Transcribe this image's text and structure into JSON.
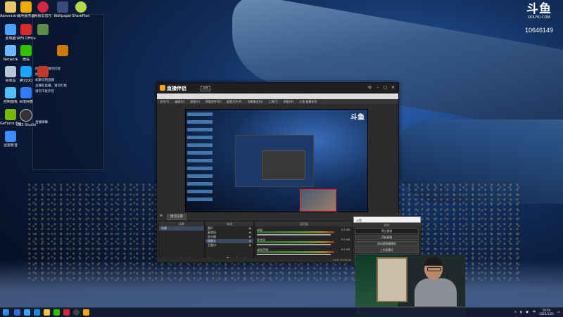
{
  "desktop": {
    "icons_col1": [
      {
        "label": "Administrat...",
        "color": "#e9c46a"
      },
      {
        "label": "此电脑",
        "color": "#4aa3ff"
      },
      {
        "label": "Network",
        "color": "#6fb8ff"
      },
      {
        "label": "回收站",
        "color": "#b8c6d8"
      },
      {
        "label": "控制面板",
        "color": "#4fc3f7"
      },
      {
        "label": "GeForce Experience",
        "color": "#76b900"
      },
      {
        "label": "迅雷影音",
        "color": "#3f8cff"
      }
    ],
    "icons_col2": [
      {
        "label": "光明服务器",
        "color": "#f2a900"
      },
      {
        "label": "WPS Office",
        "color": "#d92b2b"
      },
      {
        "label": "微信",
        "color": "#2dc100"
      },
      {
        "label": "腾讯QQ",
        "color": "#1aa3ff"
      },
      {
        "label": "百度网盘",
        "color": "#2f7cf6"
      },
      {
        "label": "OBS Studio",
        "color": "#333333"
      }
    ],
    "icons_col3": [
      {
        "label": "网易云音乐",
        "color": "#d7263d"
      },
      {
        "label": "",
        "color": "#5b8c4a"
      },
      {
        "label": "",
        "color": "#c0392b"
      },
      {
        "label": "",
        "color": "#7d5fb2"
      },
      {
        "label": "",
        "color": "#3b7dd8"
      }
    ],
    "icons_col4": [
      {
        "label": "Wallpaper",
        "color": "#3a4b7a"
      },
      {
        "label": "",
        "color": "#cc7a00"
      }
    ],
    "icons_col5": [
      {
        "label": "SharePlan",
        "color": "#b7d84a"
      }
    ],
    "notes": [
      "的直播中请勿打扰",
      "加速",
      "如果切到直播",
      "主播在直播，请勿打扰",
      "请勿干扰声音",
      "直播弹幕"
    ]
  },
  "douyu": {
    "logo": "斗鱼",
    "url": "DOUYU.COM",
    "room_id": "10646149"
  },
  "obs": {
    "brand": "直播伴侣",
    "badge": "试用",
    "menu": [
      "文件(F)",
      "编辑(E)",
      "视图(V)",
      "停靠部件(D)",
      "配置文件(P)",
      "场景集合(S)",
      "工具(T)",
      "帮助(H)",
      "斗鱼·直播伴侣"
    ],
    "preview_logo": "斗鱼",
    "tab_button": "推流设置",
    "scenes_header": "场景",
    "scenes": [
      "场景"
    ],
    "sources_header": "来源",
    "sources": [
      "图片",
      "麦克风",
      "显示器",
      "摄像头",
      "主窗口"
    ],
    "mixer_header": "混音器",
    "mixer": [
      {
        "name": "桌面",
        "db": "0.0 dB"
      },
      {
        "name": "麦克风",
        "db": "0.0 dB"
      },
      {
        "name": "桌面音频",
        "db": "0.0 dB"
      }
    ],
    "controls_header": "控件",
    "controls": [
      "停止推流",
      "开始录制",
      "启动虚拟摄像机",
      "工作室模式",
      "设置",
      "退出"
    ],
    "dropdown_value": "斗鱼",
    "status": "LIVE: 00:00:00  REC: 00:00:00  CPU: 3.4%  30.00 fps"
  },
  "taskbar": {
    "tray_lang": "中",
    "time": "16:50",
    "date": "2022/1/20"
  }
}
